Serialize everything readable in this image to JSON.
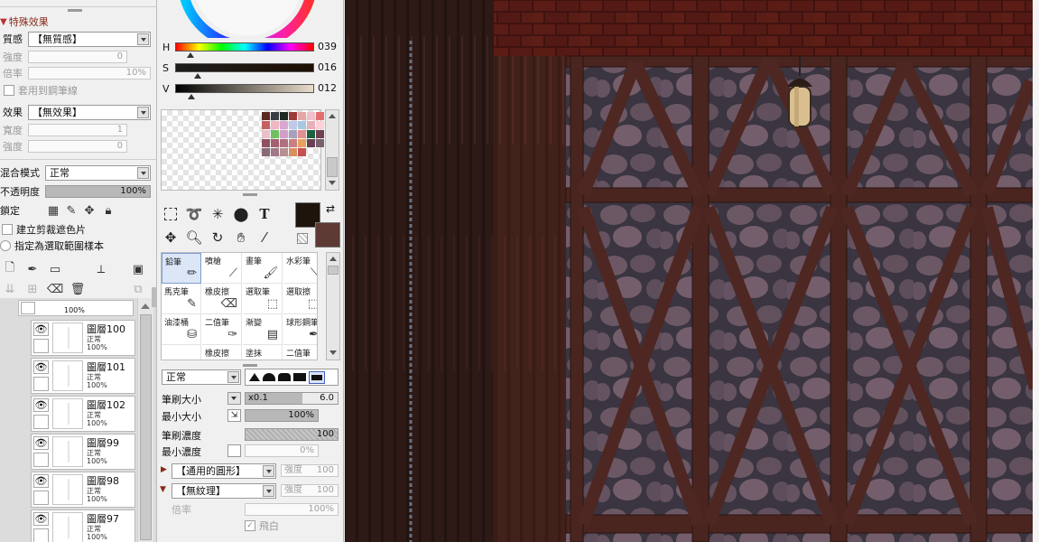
{
  "effects_panel": {
    "section_title": "特殊效果",
    "texture_label": "質感",
    "texture_value": "【無質感】",
    "strength_label": "強度",
    "strength_value": "0",
    "scale_label": "倍率",
    "scale_value": "10%",
    "apply_to_brush_label": "套用到鋼筆線",
    "effect_label": "效果",
    "effect_value": "【無效果】",
    "width_label": "寬度",
    "width_value": "1",
    "effect_strength_label": "強度",
    "effect_strength_value": "0"
  },
  "layer_props": {
    "blend_label": "混合模式",
    "blend_value": "正常",
    "opacity_label": "不透明度",
    "opacity_value": "100%",
    "lock_label": "鎖定",
    "clip_label": "建立剪裁遮色片",
    "sample_label": "指定為選取範圍樣本"
  },
  "layers": {
    "folder_pct": "100%",
    "items": [
      {
        "name": "圖層100",
        "mode": "正常",
        "opacity": "100%"
      },
      {
        "name": "圖層101",
        "mode": "正常",
        "opacity": "100%"
      },
      {
        "name": "圖層102",
        "mode": "正常",
        "opacity": "100%"
      },
      {
        "name": "圖層99",
        "mode": "正常",
        "opacity": "100%"
      },
      {
        "name": "圖層98",
        "mode": "正常",
        "opacity": "100%"
      },
      {
        "name": "圖層97",
        "mode": "正常",
        "opacity": "100%"
      }
    ]
  },
  "color": {
    "h_label": "H",
    "h_value": "039",
    "s_label": "S",
    "s_value": "016",
    "v_label": "V",
    "v_value": "012",
    "h_level": 0.11,
    "s_level": 0.16,
    "v_level": 0.12,
    "primary": "#1e140c",
    "secondary": "#5e3a35"
  },
  "swatches": [
    "#5a2a22",
    "#3a3e44",
    "#1e2a22",
    "#9b3c3c",
    "#e4a6a6",
    "#f0c0c8",
    "#e07070",
    "#c56060",
    "#f2b6c2",
    "#d8a8d0",
    "#c0c8e8",
    "#a8c8e0",
    "#e8b0b8",
    "#ffd0d8",
    "#e8c0c8",
    "#70c060",
    "#d0a0c8",
    "#a8a0c0",
    "#e09090",
    "#1c6040",
    "#704050",
    "#905060",
    "#a06070",
    "#b07080",
    "#c88080",
    "#e8a060",
    "#684050",
    "#786070",
    "#8a6878",
    "#a07888",
    "#b89090",
    "#d89060",
    "#c85050"
  ],
  "brushes": [
    {
      "name": "鉛筆",
      "icon": "pencil-icon"
    },
    {
      "name": "噴槍",
      "icon": "airbrush-icon"
    },
    {
      "name": "畫筆",
      "icon": "brush-icon"
    },
    {
      "name": "水彩筆",
      "icon": "watercolor-icon"
    },
    {
      "name": "馬克筆",
      "icon": "marker-icon"
    },
    {
      "name": "橡皮擦",
      "icon": "eraser-icon"
    },
    {
      "name": "選取筆",
      "icon": "select-pen-icon"
    },
    {
      "name": "選取擦",
      "icon": "select-eraser-icon"
    },
    {
      "name": "油漆桶",
      "icon": "bucket-icon"
    },
    {
      "name": "二值筆",
      "icon": "binary-pen-icon"
    },
    {
      "name": "漸變",
      "icon": "gradient-icon"
    },
    {
      "name": "球形鋼筆",
      "icon": "pen-icon"
    },
    {
      "name": "",
      "icon": ""
    },
    {
      "name": "橡皮擦",
      "icon": "eraser-icon"
    },
    {
      "name": "塗抹",
      "icon": "smudge-icon"
    },
    {
      "name": "二值筆",
      "icon": "binary-pen-icon"
    }
  ],
  "brush_settings": {
    "blend_value": "正常",
    "size_label": "筆刷大小",
    "size_multiplier": "x0.1",
    "size_value": "6.0",
    "min_size_label": "最小大小",
    "min_size_value": "100%",
    "density_label": "筆刷濃度",
    "density_value": "100",
    "min_density_label": "最小濃度",
    "min_density_value": "0%",
    "shape_value": "【通用的圓形】",
    "shape_strength_label": "強度",
    "shape_strength_value": "100",
    "texture_value": "【無紋理】",
    "texture_strength_label": "強度",
    "texture_strength_value": "100",
    "scale_label": "倍率",
    "scale_value": "100%",
    "white_label": "飛白"
  }
}
